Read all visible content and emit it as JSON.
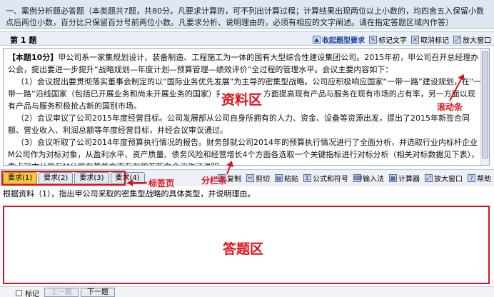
{
  "instructions": "一、案例分析题必答题（本类题共7题，共80分。凡要求计算的，可不列出计算过程；计算结果出现两位以上小数的，均四舍五入保留小数点后两位小数，百分比只保留百分号前两位小数。凡要求分析、说明理由的，必须有相应的文字阐述。请在指定答题区域内作答）",
  "question_bar": {
    "number": "第 1 题",
    "tools": [
      "收起题型要求",
      "标记文字",
      "取消标记",
      "放大窗口"
    ]
  },
  "material": {
    "score_tag": "【本题10分】",
    "paragraphs": [
      "甲公司系一家集规划设计、装备制造、工程施工为一体的国有大型综合性建设集团公司。2015年初，甲公司召开总经理办公会，提出要进一步提升“战略规划—年度计划—预算管理—绩效评价”全过程的管理水平。会议主要内容如下：",
      "（1）会议提出要贯彻落实董事会制定的以“国际业务优先发展”为主导的密集型战略。公司应积极响应国家“一带一路”建设规划，在“一带一路”沿线国家（包括已开展业务和尚未开展业务的国家）拓展业务，一方面提高现有产品与服务在现有市场的占有率，另一方面以现有产品与服务积极抢占新的国别市场。",
      "（2）会议审议了公司2015年度经营目标。公司发展部从公司自身所拥有的人力、资金、设备等资源出发，提出了2015年新签合同额、营业收入、利润总额等年度经营目标，并经会议审议通过。",
      "（3）会议听取了公司2014年度预算执行情况的报告。财务部就公司2014年的预算执行情况进行了全面分析，并选取行业内标杆企业M公司作为对标对象，从盈利水平、资产质量、债务风险和经营增长4个方面各选取一个关键指标进行对标分析（相关对标数据见下表），重点就本公司与M公司在某些方面存在的差距向会议作了说明。"
    ]
  },
  "annotations": {
    "material_area": "资料区",
    "scrollbar": "滚动条",
    "tab_pages": "标签页",
    "splitter": "分栏条",
    "answer_area": "答题区"
  },
  "tabs": [
    "要求(1)",
    "要求(2)",
    "要求(3)",
    "要求(4)"
  ],
  "right_tools": [
    "复制",
    "剪切",
    "粘贴",
    "公式和符号",
    "输入法",
    "计算器",
    "放大窗口",
    "帮助"
  ],
  "question_text": "根据资料（1），指出甲公司采取的密集型战略的具体类型，并说明理由。",
  "answer_value": "",
  "footer": {
    "mark_label": "标记",
    "prev_label": "上一题",
    "next_label": "下一题"
  },
  "colors": {
    "annotation_red": "#e0111a",
    "active_tab": "#f6c74c",
    "header_bg": "#dfe7f3"
  }
}
